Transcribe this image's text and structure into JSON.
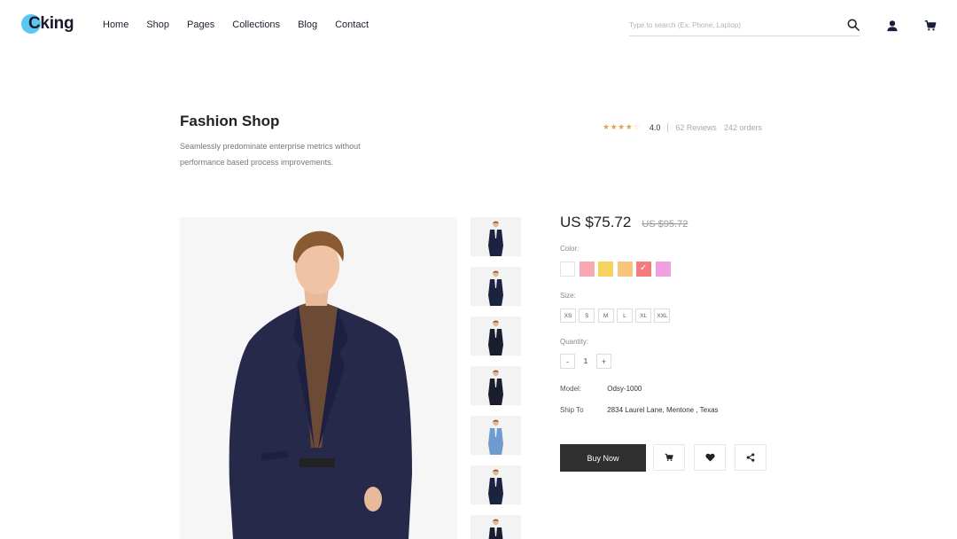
{
  "brand": {
    "logo_text": "Cking",
    "accent": "#5bc8f2"
  },
  "nav": {
    "items": [
      "Home",
      "Shop",
      "Pages",
      "Collections",
      "Blog",
      "Contact"
    ]
  },
  "search": {
    "placeholder": "Type to search (Ex: Phone, Laptop)",
    "icon": "search-icon"
  },
  "header_icons": [
    "user-icon",
    "cart-icon"
  ],
  "page": {
    "title": "Fashion Shop",
    "subtitle": "Seamlessly predominate enterprise metrics without performance based process improvements."
  },
  "rating": {
    "stars": 4,
    "max_stars": 5,
    "value": "4.0",
    "reviews": "62 Reviews",
    "orders": "242 orders",
    "star_color": "#e0a24a"
  },
  "product": {
    "price": "US $75.72",
    "old_price": "US $95.72",
    "color_label": "Color:",
    "colors": [
      "#ffffff",
      "#f9a7b0",
      "#f4d35e",
      "#f7c57e",
      "#f47c7c",
      "#f0a0de"
    ],
    "selected_color_index": 4,
    "size_label": "Size:",
    "sizes": [
      "XS",
      "S",
      "M",
      "L",
      "XL",
      "XXL"
    ],
    "quantity_label": "Quantity:",
    "quantity": "1",
    "qty_minus": "-",
    "qty_plus": "+",
    "model_label": "Model:",
    "model_value": "Odsy-1000",
    "ship_label": "Ship To",
    "ship_value": "2834 Laurel Lane, Mentone , Texas",
    "buy_label": "Buy Now"
  },
  "thumbnail_suit_colors": [
    "#1c2340",
    "#1c2340",
    "#1a1d2e",
    "#1a1d2e",
    "#6f9bd0",
    "#1c2340",
    "#1a1d2e"
  ]
}
